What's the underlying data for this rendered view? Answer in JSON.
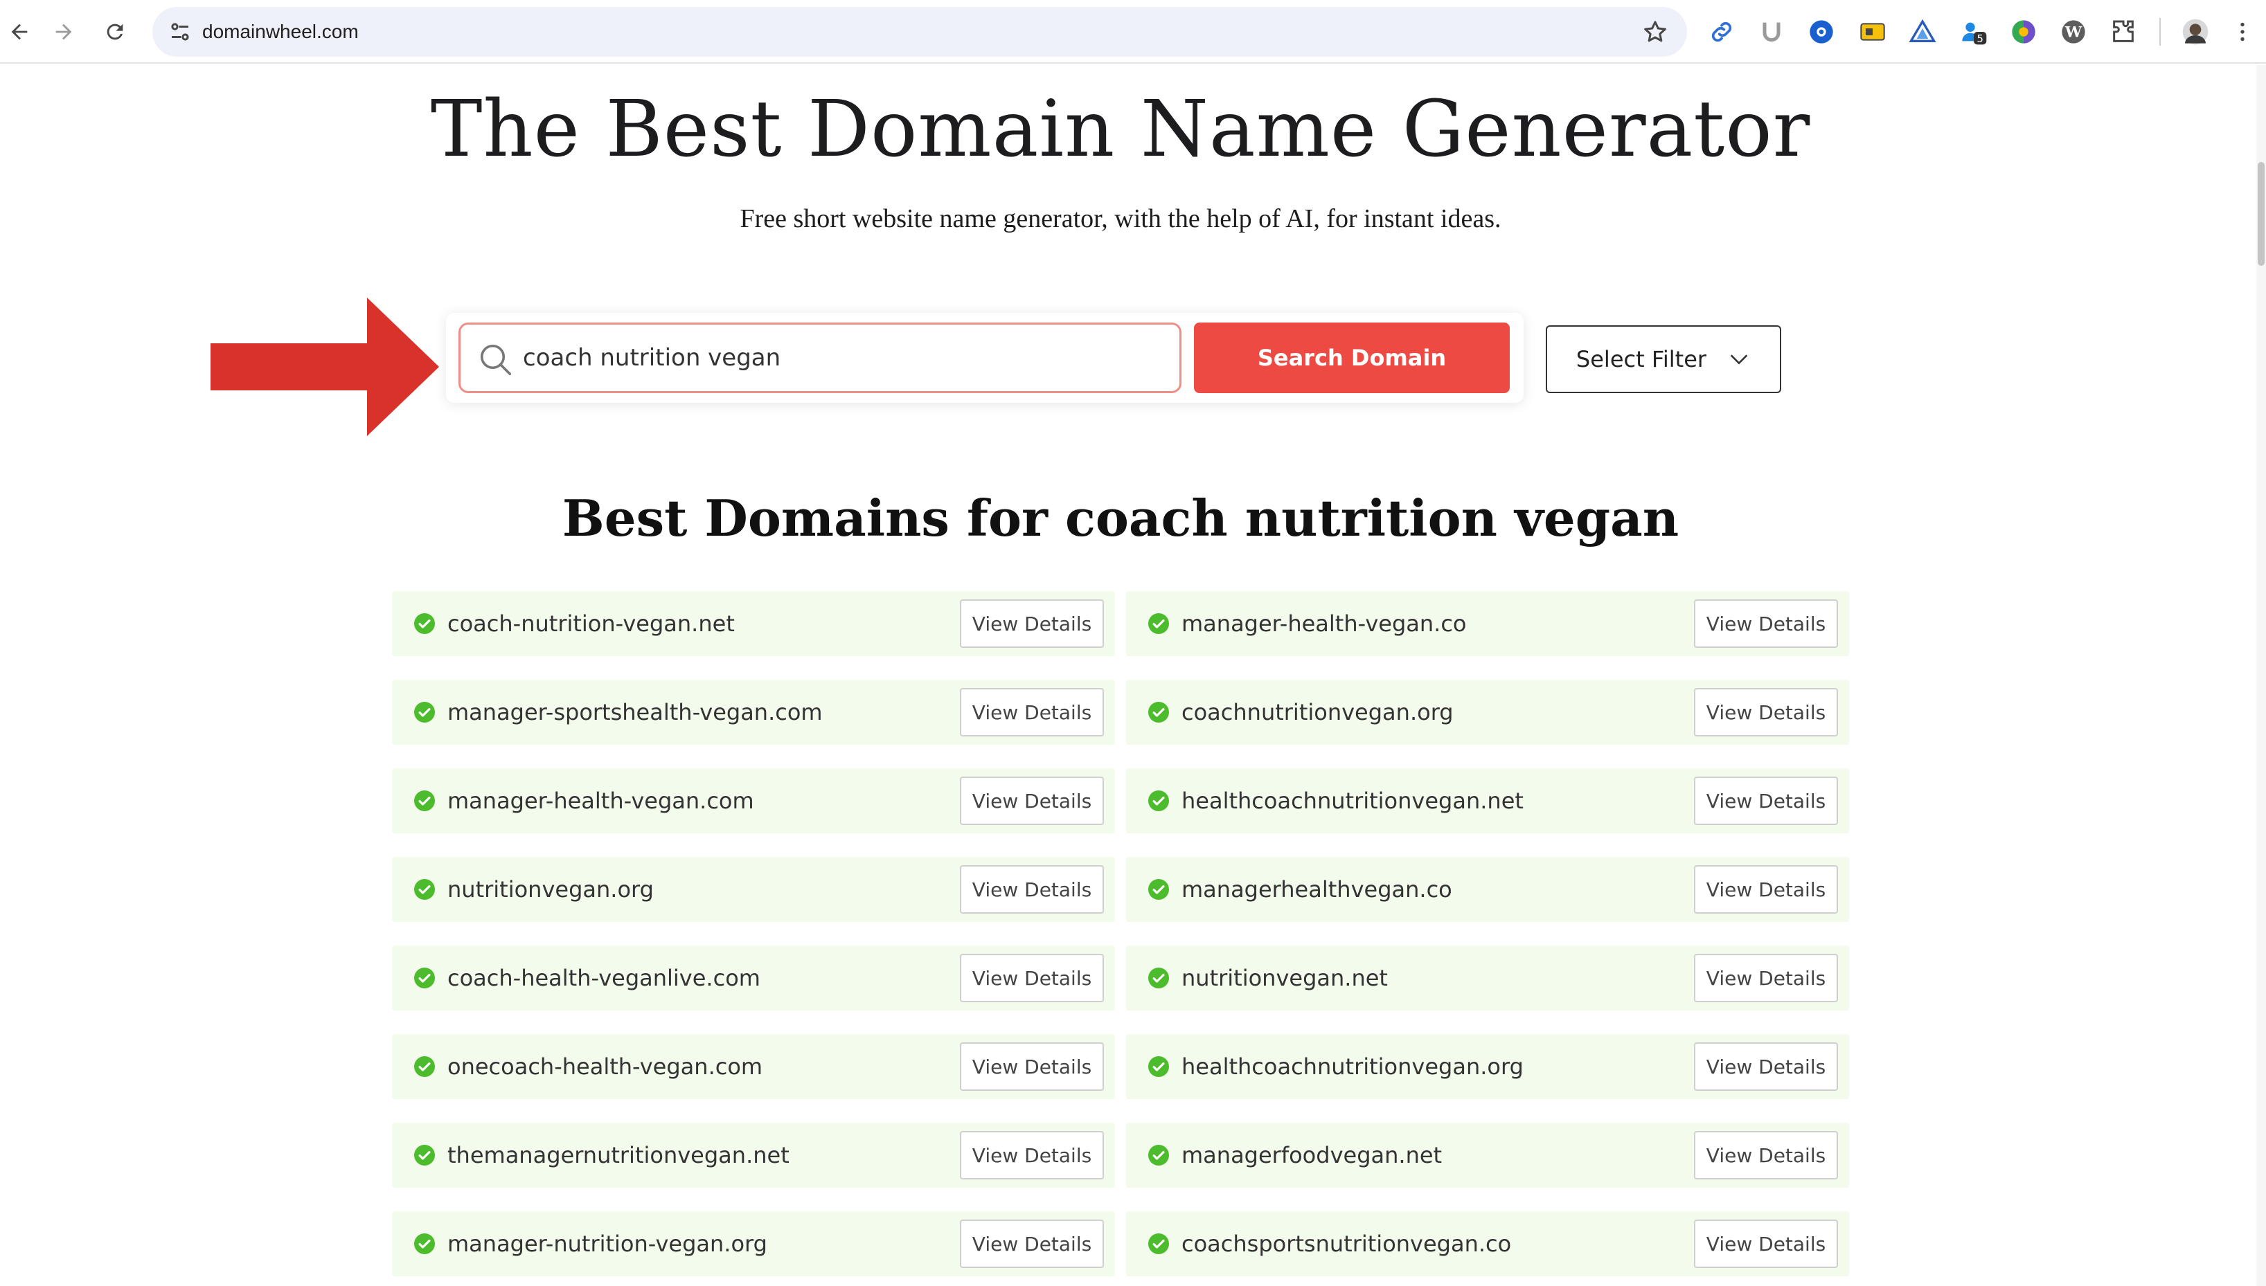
{
  "browser": {
    "url": "domainwheel.com",
    "extension_badge": "5"
  },
  "hero": {
    "title": "The Best Domain Name Generator",
    "subtitle": "Free short website name generator, with the help of AI, for instant ideas."
  },
  "search": {
    "value": "coach nutrition vegan",
    "button_label": "Search Domain"
  },
  "filter": {
    "label": "Select Filter"
  },
  "results": {
    "heading_prefix": "Best Domains for ",
    "heading_query": "coach nutrition vegan",
    "details_label": "View Details",
    "items": [
      "coach-nutrition-vegan.net",
      "manager-health-vegan.co",
      "manager-sportshealth-vegan.com",
      "coachnutritionvegan.org",
      "manager-health-vegan.com",
      "healthcoachnutritionvegan.net",
      "nutritionvegan.org",
      "managerhealthvegan.co",
      "coach-health-veganlive.com",
      "nutritionvegan.net",
      "onecoach-health-vegan.com",
      "healthcoachnutritionvegan.org",
      "themanagernutritionvegan.net",
      "managerfoodvegan.net",
      "manager-nutrition-vegan.org",
      "coachsportsnutritionvegan.co"
    ]
  },
  "colors": {
    "accent_red": "#ee4a44",
    "result_bg": "#f3fbec",
    "check_green": "#4cbb2c"
  }
}
